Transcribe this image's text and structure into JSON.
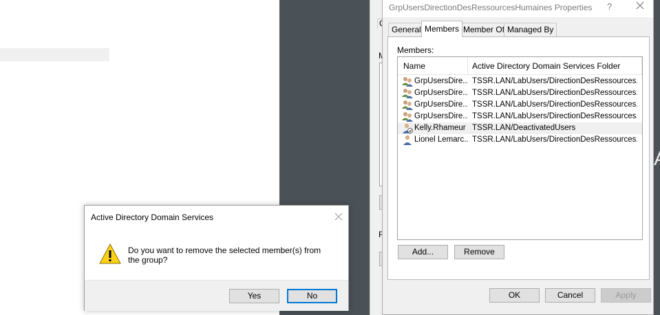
{
  "properties_dialog": {
    "title": "GrpUsersDirectionDesRessourcesHumaines Properties",
    "help_glyph": "?",
    "tabs": [
      {
        "label": "General",
        "active": false
      },
      {
        "label": "Members",
        "active": true
      },
      {
        "label": "Member Of",
        "active": false
      },
      {
        "label": "Managed By",
        "active": false
      }
    ],
    "members_label": "Members:",
    "columns": [
      "Name",
      "Active Directory Domain Services Folder"
    ],
    "rows": [
      {
        "icon": "group-icon",
        "name": "GrpUsersDire...",
        "folder": "TSSR.LAN/LabUsers/DirectionDesRessources...",
        "selected": false
      },
      {
        "icon": "group-icon",
        "name": "GrpUsersDire...",
        "folder": "TSSR.LAN/LabUsers/DirectionDesRessources...",
        "selected": false
      },
      {
        "icon": "group-icon",
        "name": "GrpUsersDire...",
        "folder": "TSSR.LAN/LabUsers/DirectionDesRessources...",
        "selected": false
      },
      {
        "icon": "group-icon",
        "name": "GrpUsersDire...",
        "folder": "TSSR.LAN/LabUsers/DirectionDesRessources...",
        "selected": false
      },
      {
        "icon": "disabled-user-icon",
        "name": "Kelly.Rhameur",
        "folder": "TSSR.LAN/DeactivatedUsers",
        "selected": true
      },
      {
        "icon": "user-icon",
        "name": "Lionel Lemarc...",
        "folder": "TSSR.LAN/LabUsers/DirectionDesRessources...",
        "selected": false
      }
    ],
    "add_button": "Add...",
    "remove_button": "Remove",
    "ok_button": "OK",
    "cancel_button": "Cancel",
    "apply_button": "Apply"
  },
  "background": {
    "behind_fragments": [
      "G",
      "M",
      "F"
    ],
    "desktop_glyph": "A"
  },
  "message_box": {
    "title": "Active Directory Domain Services",
    "message": "Do you want to remove the selected member(s) from the group?",
    "yes_button": "Yes",
    "no_button": "No"
  },
  "colors": {
    "desktop": "#4a5157",
    "dialog_bg": "#f0f0f0",
    "focus_blue": "#0078d7",
    "warning_yellow": "#fcd116"
  }
}
